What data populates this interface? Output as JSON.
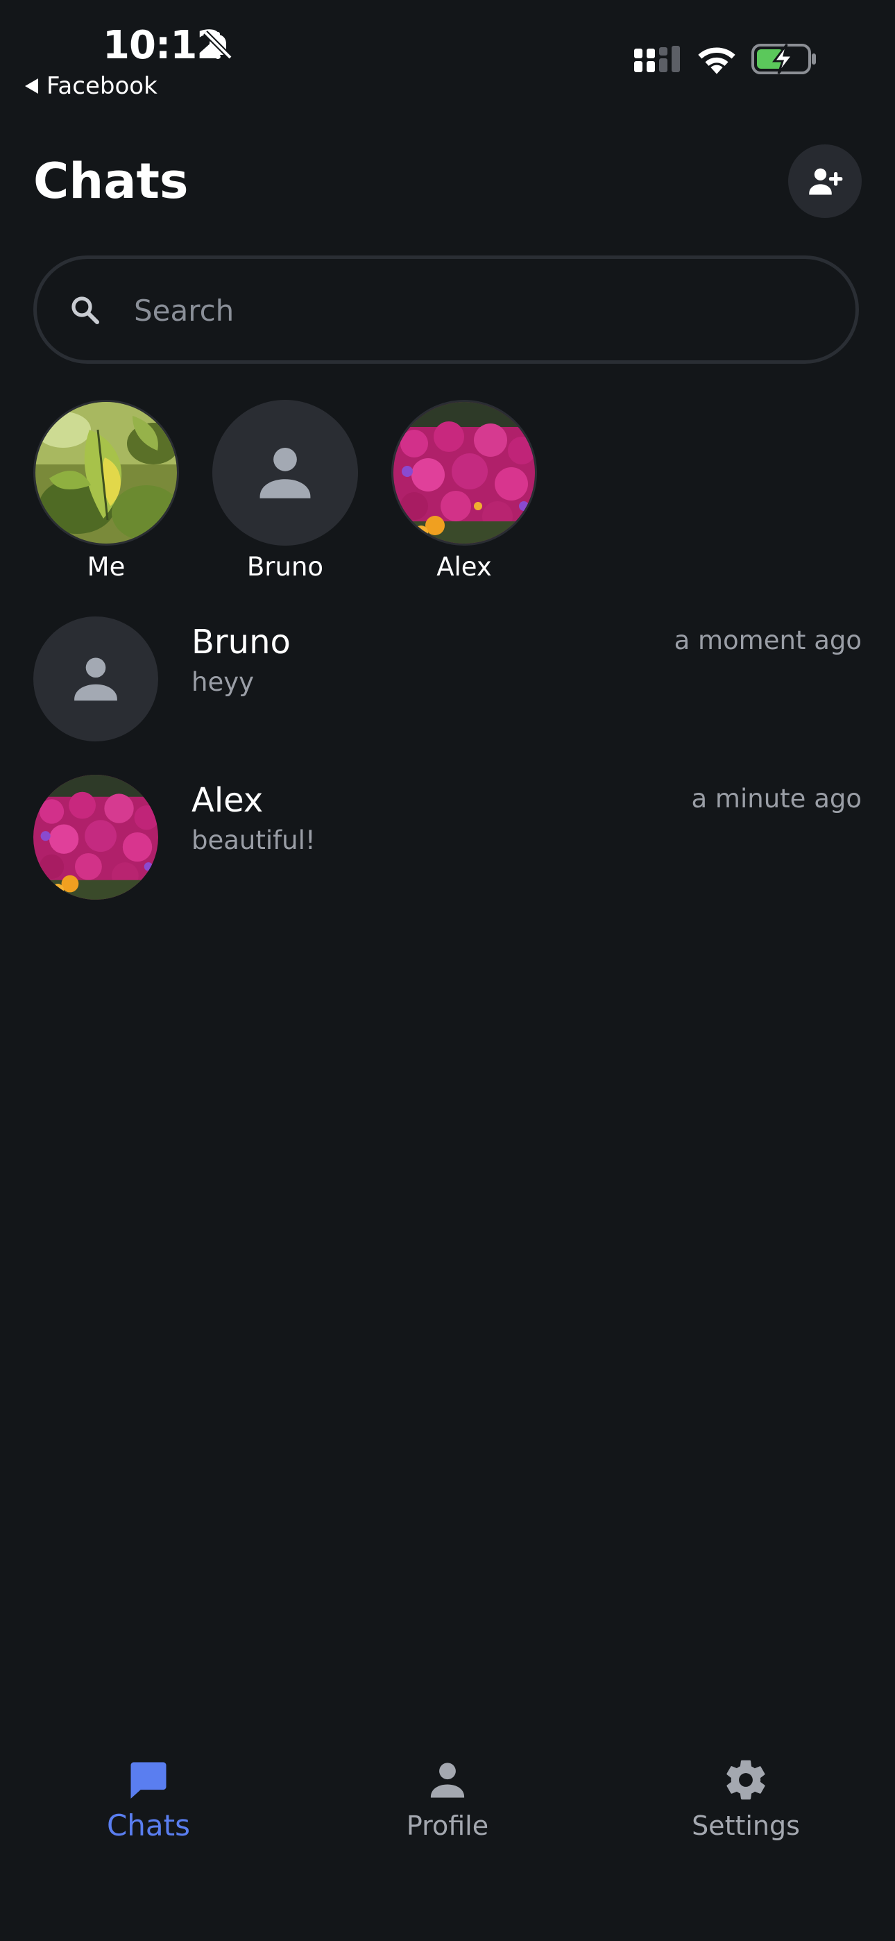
{
  "status_bar": {
    "time": "10:12",
    "back_label": "Facebook"
  },
  "header": {
    "title": "Chats",
    "add_contact_icon": "add-user-icon"
  },
  "search": {
    "placeholder": "Search",
    "value": ""
  },
  "stories": [
    {
      "label": "Me",
      "avatar": "photo-leaves"
    },
    {
      "label": "Bruno",
      "avatar": "placeholder-person"
    },
    {
      "label": "Alex",
      "avatar": "photo-flowers"
    }
  ],
  "chats": [
    {
      "name": "Bruno",
      "preview": "heyy",
      "time": "a moment ago",
      "avatar": "placeholder-person"
    },
    {
      "name": "Alex",
      "preview": "beautiful!",
      "time": "a minute ago",
      "avatar": "photo-flowers"
    }
  ],
  "nav": {
    "items": [
      {
        "label": "Chats",
        "icon": "chat-bubble-icon",
        "active": true
      },
      {
        "label": "Profile",
        "icon": "person-icon",
        "active": false
      },
      {
        "label": "Settings",
        "icon": "gear-icon",
        "active": false
      }
    ]
  },
  "colors": {
    "background": "#131619",
    "surface": "#272a30",
    "accent": "#5a7ef0",
    "muted_text": "#9a9ea6",
    "battery_charge": "#5bc85b"
  }
}
